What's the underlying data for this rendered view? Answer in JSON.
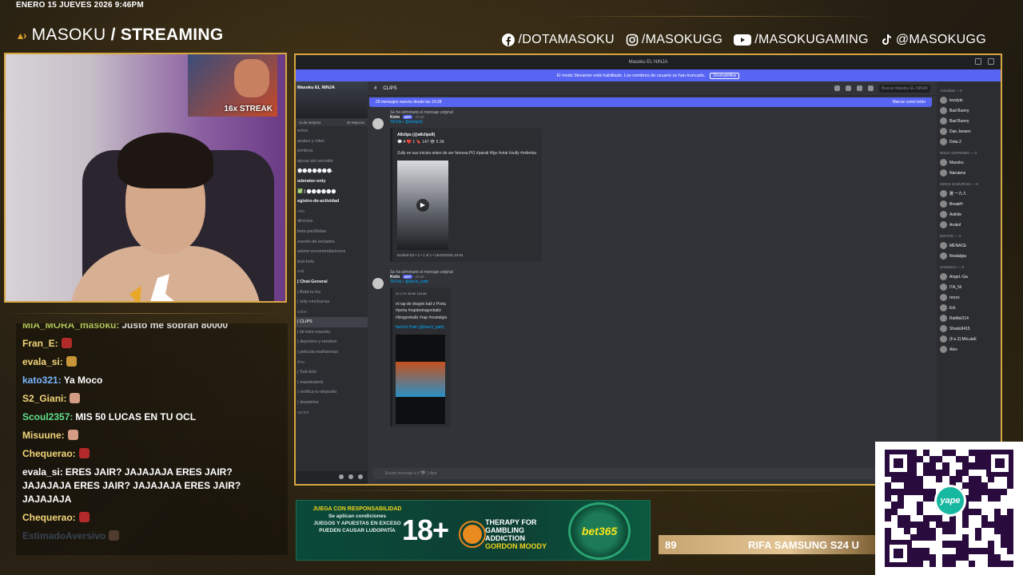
{
  "overlay": {
    "datetime": "ENERO 15 JUEVES 2026 9:46PM",
    "brand_light": "MASOKU",
    "brand_bold": "/ STREAMING",
    "socials": [
      {
        "icon": "facebook-icon",
        "label": "/DOTAMASOKU"
      },
      {
        "icon": "instagram-icon",
        "label": "/MASOKUGG"
      },
      {
        "icon": "youtube-icon",
        "label": "/MASOKUGAMING"
      },
      {
        "icon": "tiktok-icon",
        "label": "@MASOKUGG"
      }
    ],
    "streak": "16x STREAK",
    "accent": "#d8a640"
  },
  "chat": [
    {
      "user": "MIA_MORA_masoku:",
      "color": "#c9e266",
      "text": "Justo me sobran 80000",
      "emotes": 0,
      "emote_style": "",
      "cls": "clipped"
    },
    {
      "user": "Fran_E:",
      "color": "#f2d67a",
      "text": "",
      "emotes": 1,
      "emote_style": "",
      "cls": ""
    },
    {
      "user": "evala_si:",
      "color": "#f2d67a",
      "text": "",
      "emotes": 1,
      "emote_style": "gold",
      "cls": ""
    },
    {
      "user": "kato321:",
      "color": "#7ab8ff",
      "text": "Ya Moco",
      "emotes": 0,
      "emote_style": "",
      "cls": ""
    },
    {
      "user": "S2_Giani:",
      "color": "#f2d67a",
      "text": "",
      "emotes": 1,
      "emote_style": "face",
      "cls": ""
    },
    {
      "user": "Scoul2357:",
      "color": "#5fe08a",
      "text": "MIS 50 LUCAS EN TU OCL",
      "emotes": 0,
      "emote_style": "",
      "cls": ""
    },
    {
      "user": "Misuune:",
      "color": "#f2d67a",
      "text": "",
      "emotes": 1,
      "emote_style": "face",
      "cls": ""
    },
    {
      "user": "Chequerao:",
      "color": "#f2d67a",
      "text": "",
      "emotes": 1,
      "emote_style": "",
      "cls": ""
    },
    {
      "user": "evala_si:",
      "color": "#ffffff",
      "text": "ERES JAIR? JAJAJAJA ERES JAIR? JAJAJAJA ERES JAIR? JAJAJAJA ERES JAIR? JAJAJAJA",
      "emotes": 0,
      "emote_style": "",
      "cls": ""
    },
    {
      "user": "Chequerao:",
      "color": "#f2d67a",
      "text": "",
      "emotes": 1,
      "emote_style": "",
      "cls": ""
    },
    {
      "user": "EstimadoAversivo",
      "color": "#7ab8ff",
      "text": "",
      "emotes": 1,
      "emote_style": "face",
      "cls": "faded"
    }
  ],
  "discord": {
    "window_title": "Masoku EL NINJA",
    "banner_text": "El modo Streamer está habilitado. Los nombres de usuario se han truncado.",
    "banner_button": "Deshabilitar",
    "server_name": "Masoku EL NINJA",
    "boost_left": "ra de mejoras",
    "boost_right": "25 Mejoras",
    "channels": [
      {
        "name": "entos",
        "cls": ""
      },
      {
        "name": "anales y roles",
        "cls": ""
      },
      {
        "name": "iembros",
        "cls": ""
      },
      {
        "name": "ejoras del servidor",
        "cls": ""
      },
      {
        "name": "⬤⬤⬤⬤⬤⬤⬤.",
        "cls": "bold"
      },
      {
        "name": "oderator-only",
        "cls": "bold"
      },
      {
        "name": "✅ | ⬤⬤⬤⬤⬤⬤",
        "cls": "bold"
      },
      {
        "name": "egistro-de-actividad",
        "cls": "bold"
      },
      {
        "name": "ncio",
        "cls": "cat"
      },
      {
        "name": "directos",
        "cls": ""
      },
      {
        "name": "bots-pacillistas",
        "cls": ""
      },
      {
        "name": "evento-de-teclados",
        "cls": ""
      },
      {
        "name": "anime-recomendaciones",
        "cls": ""
      },
      {
        "name": "test-bots",
        "cls": ""
      },
      {
        "name": "eral",
        "cls": "cat"
      },
      {
        "name": "| Chat-General",
        "cls": "bold"
      },
      {
        "name": "| Bota-tu-Ira",
        "cls": ""
      },
      {
        "name": "| only-vinchurras",
        "cls": ""
      },
      {
        "name": "ccion",
        "cls": "cat"
      },
      {
        "name": "| CLIPS",
        "cls": "active"
      },
      {
        "name": "| tik-toks-masoku",
        "cls": ""
      },
      {
        "name": "| deportes-y-random",
        "cls": ""
      },
      {
        "name": "| pelicula-mañaneras",
        "cls": ""
      },
      {
        "name": "ifica",
        "cls": "cat"
      },
      {
        "name": "| Sub-kick",
        "cls": ""
      },
      {
        "name": "| masokubets",
        "cls": ""
      },
      {
        "name": "| verifica-tu-deposito",
        "cls": ""
      },
      {
        "name": "| dosetelos",
        "cls": ""
      },
      {
        "name": "uccion",
        "cls": "cat"
      }
    ],
    "channel_name": "CLIPS",
    "search_placeholder": "Buscar Masoku EL NINJA",
    "new_messages": "29 mensajes nuevos desde las 19:28",
    "mark_read": "Marcar como leído",
    "messages": [
      {
        "reply": "Se ha eliminado el mensaje original",
        "author": "Keto",
        "app": "APP",
        "time": "20:09",
        "link": "TikTok • @alclips9",
        "embed_title": "Allclips (@allclips9)",
        "embed_stats": "💬 4  ❤️ 1  🔖 147  👁 5.3K",
        "embed_desc": "Zully en sus inicios antes de ser famosa Pt1 #parati #fyp #viral #zully #milenka",
        "embed_footer": "Embed EZ • 1 • 1 of 1 • 15/10/2025 10:53"
      },
      {
        "reply": "Se ha eliminado el mensaje original",
        "author": "Keto",
        "app": "APP",
        "time": "20:08",
        "link": "TikTok • @itachi_path",
        "embed_stats": "22  4.7K  39.6K  154.8K",
        "embed_desc": "el rap de dragón ball z Porta #porta #rapdedragonballz #dragonballz #rap #nostalgia",
        "embed_author": "Itachi's Path (@itachi_path)"
      }
    ],
    "input_placeholder": "Enviar mensaje a # 🎬 | clips",
    "members": [
      {
        "cat": "Actividad — 6",
        "items": [
          "lezstyle",
          "Bad Bunny",
          "Bad Bunny",
          "Dan Jansen",
          "Dota 2"
        ]
      },
      {
        "cat": "NINJA SUPREMO — 2",
        "items": [
          "Masoku",
          "Narutenz"
        ]
      },
      {
        "cat": "MODS SAMURAIS — 9",
        "items": [
          "雅 一た人",
          "BreakH",
          "Aoikite",
          "Arukol"
        ]
      },
      {
        "cat": "EDITOR — 2",
        "items": [
          "MENACE",
          "Nostalgia"
        ]
      },
      {
        "cat": "SAMURAI — 9",
        "items": [
          "AngeL-Ga",
          "ITA_Ni",
          "renzo",
          "Erk",
          "RaiMaO14",
          "Shadu9415",
          "(F.e.2) MrLuisE",
          "Alex"
        ]
      }
    ]
  },
  "ad": {
    "left_title": "JUEGA CON RESPONSABILIDAD",
    "left_sub": "Se aplican condiciones",
    "left_warning": "JUEGOS Y APUESTAS EN EXCESO PUEDEN CAUSAR LUDOPATÍA",
    "age": "18+",
    "therapy_title": "THERAPY FOR GAMBLING ADDICTION",
    "therapy_sub": "GORDON MOODY",
    "brand": "bet365"
  },
  "ticker": {
    "number": "89",
    "text": "RIFA SAMSUNG S24 U"
  },
  "qr": {
    "logo_text": "yape"
  }
}
